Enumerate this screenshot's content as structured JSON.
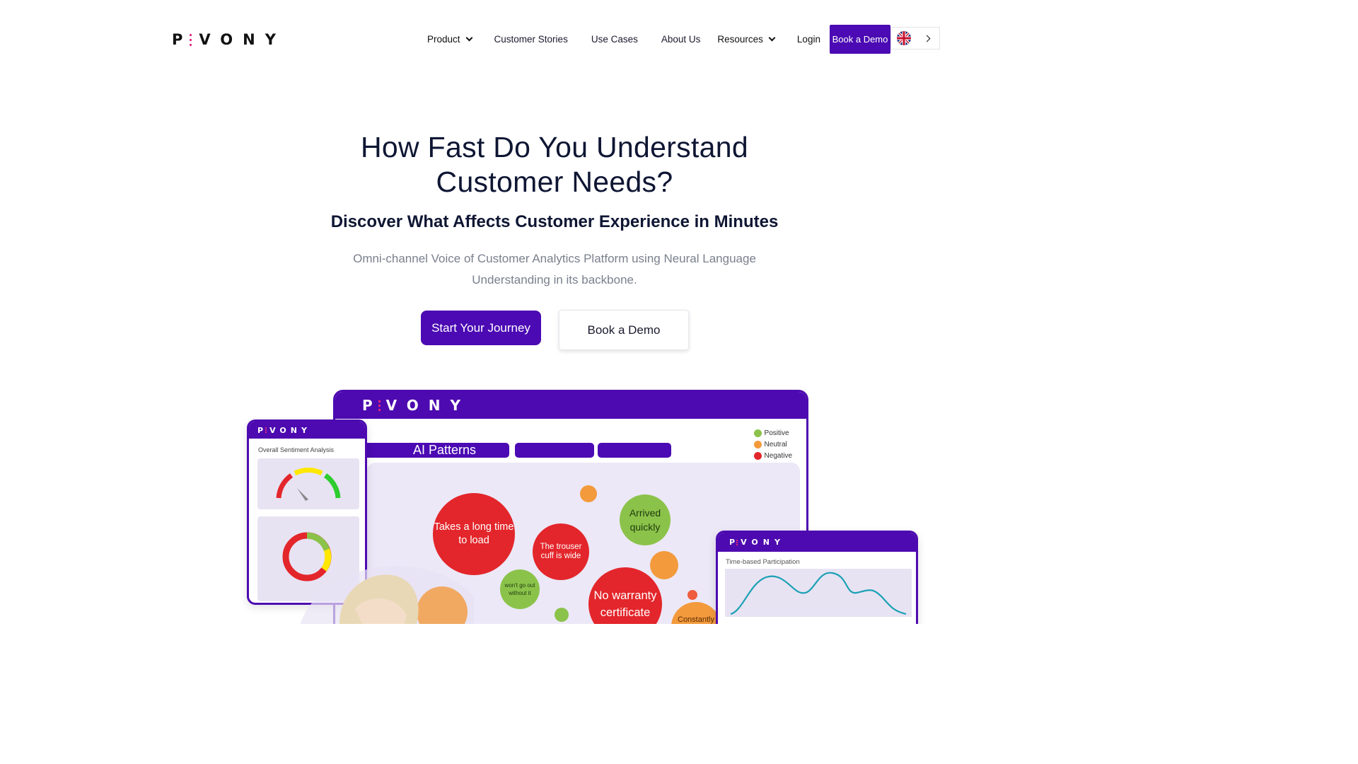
{
  "brand": {
    "logo_text": "P",
    "logo_rest": "VONY"
  },
  "nav": {
    "items": [
      {
        "label": "Product",
        "has_dropdown": true
      },
      {
        "label": "Customer Stories",
        "has_dropdown": false
      },
      {
        "label": "Use Cases",
        "has_dropdown": false
      },
      {
        "label": "About Us",
        "has_dropdown": false
      },
      {
        "label": "Resources",
        "has_dropdown": true
      },
      {
        "label": "Login",
        "has_dropdown": false
      }
    ],
    "cta": "Book a Demo",
    "language_icon": "uk-flag-icon"
  },
  "hero": {
    "title_line1": "How Fast Do You Understand",
    "title_line2": "Customer Needs?",
    "subtitle": "Discover What Affects Customer Experience in Minutes",
    "description_line1": "Omni-channel Voice of Customer Analytics Platform using Neural Language",
    "description_line2": "Understanding in its backbone.",
    "primary_button": "Start Your Journey",
    "secondary_button": "Book a Demo"
  },
  "mockup": {
    "dashboard_logo": "P",
    "dashboard_logo_rest": "VONY",
    "pattern_tab": "AI Patterns",
    "legend": [
      "Positive",
      "Neutral",
      "Negative"
    ],
    "bubbles": [
      "Takes a long time to load",
      "The trouser cuff is wide",
      "Arrived quickly",
      "won't go out without it",
      "No warranty certificate",
      "Constantly"
    ],
    "phone_title": "Overall Sentiment Analysis",
    "chart_title": "Time-based Participation"
  },
  "colors": {
    "brand_purple": "#4b0ab3",
    "positive": "#8bc34a",
    "neutral": "#f39a3d",
    "negative": "#e3262b"
  }
}
